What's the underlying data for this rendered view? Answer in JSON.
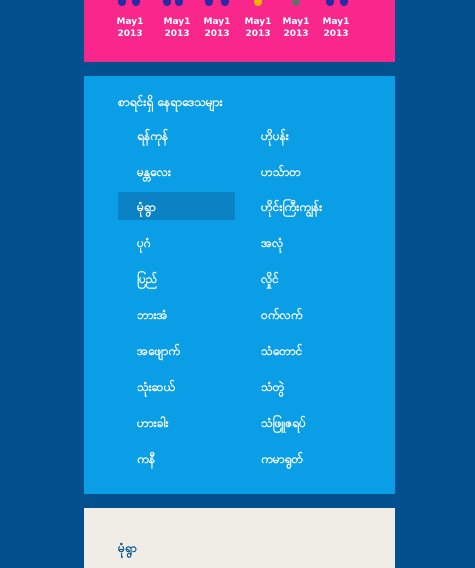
{
  "dates": [
    {
      "month": "May1",
      "year": "2013"
    },
    {
      "month": "May1",
      "year": "2013"
    },
    {
      "month": "May1",
      "year": "2013"
    },
    {
      "month": "May1",
      "year": "2013"
    },
    {
      "month": "May1",
      "year": "2013"
    },
    {
      "month": "May1",
      "year": "2013"
    }
  ],
  "panel": {
    "title": "စာရင်းရှိ နေရာဒေသများ",
    "left_cities": [
      "ရန်ကုန်",
      "မန္တလေး",
      "မုံရွာ",
      "ပုဂံ",
      "ပြည်",
      "ဘားအံ",
      "အဖျောက်",
      "သုံးဆယ်",
      "ဟားခါး",
      "ကနီ"
    ],
    "right_cities": [
      "ဟိုပန်း",
      "ဟသ်ာတ",
      "ဟိုင်းကြီးကျွန်း",
      "အလုံ",
      "လှိုင်",
      "ဝက်လက်",
      "သံတောင်",
      "သံတွဲ",
      "သံဖြူဇရပ်",
      "ကမာရွတ်"
    ],
    "selected": "မုံရွာ"
  },
  "bottom": {
    "label": "မုံရွာ"
  },
  "colors": {
    "background": "#03508e",
    "pink": "#f9268c",
    "panel_blue": "#0a9ee6",
    "selected_blue": "#0b82c4",
    "bottom_panel": "#efede6"
  }
}
